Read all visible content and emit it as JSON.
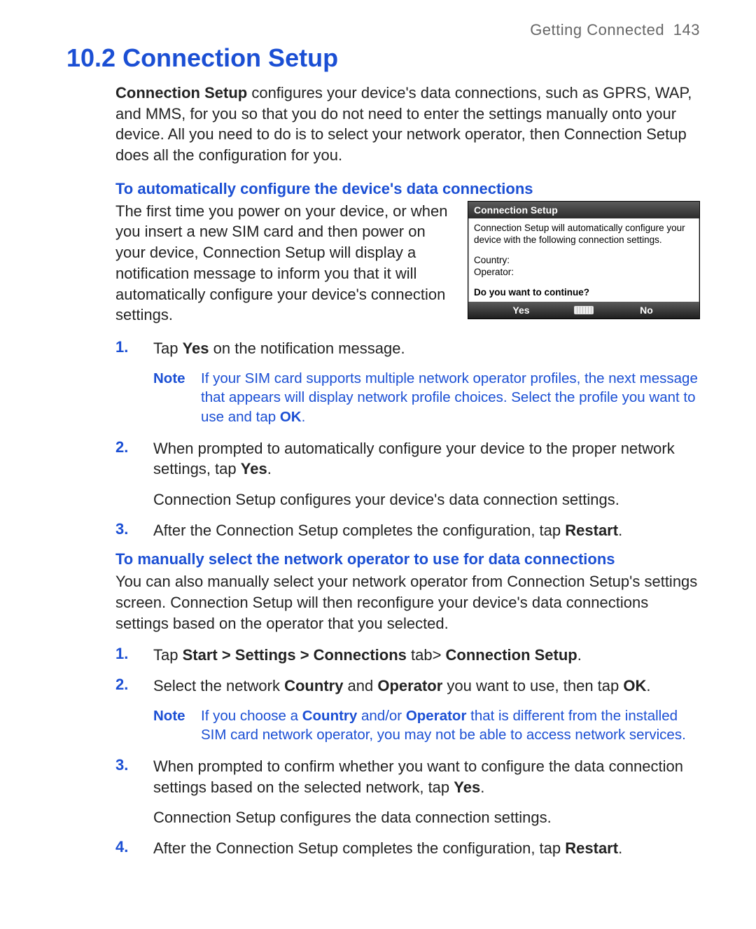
{
  "header": {
    "chapter": "Getting Connected",
    "page": "143"
  },
  "title": "10.2  Connection Setup",
  "intro": {
    "lead_bold": "Connection Setup",
    "text": " configures your device's data connections, such as GPRS, WAP, and MMS, for you so that you do not need to enter the settings manually onto your device. All you need to do is to select your network operator, then Connection Setup does all the configuration for you."
  },
  "auto": {
    "heading": "To automatically configure the device's data connections",
    "para": "The first time you power on your device, or when you insert a new SIM card and then power on your device, Connection Setup will display a notification message to inform you that it will automatically configure your device's connection settings."
  },
  "dialog": {
    "title": "Connection Setup",
    "message": "Connection Setup will automatically configure your device with the following connection settings.",
    "country_label": "Country:",
    "operator_label": "Operator:",
    "confirm": "Do you want to continue?",
    "yes": "Yes",
    "no": "No"
  },
  "steps_a": {
    "s1": {
      "num": "1.",
      "pre": "Tap ",
      "b": "Yes",
      "post": " on the notification message."
    },
    "note": {
      "label": "Note",
      "text_pre": "If your SIM card supports multiple network operator profiles, the next message that appears will display network profile choices. Select the profile you want to use and tap ",
      "b": "OK",
      "text_post": "."
    },
    "s2": {
      "num": "2.",
      "pre": "When prompted to automatically configure your device to the proper network settings, tap ",
      "b": "Yes",
      "post": ".",
      "follow": "Connection Setup configures your device's data connection settings."
    },
    "s3": {
      "num": "3.",
      "pre": "After the Connection Setup completes the configuration, tap ",
      "b": "Restart",
      "post": "."
    }
  },
  "manual": {
    "heading": "To manually select the network operator to use for data connections",
    "para": "You can also manually select your network operator from Connection Setup's settings screen. Connection Setup will then reconfigure your device's data connections settings based on the operator that you selected."
  },
  "steps_b": {
    "s1": {
      "num": "1.",
      "pre": "Tap ",
      "b": "Start > Settings > Connections",
      "mid": " tab> ",
      "b2": "Connection Setup",
      "post": "."
    },
    "s2": {
      "num": "2.",
      "pre": "Select the network ",
      "b": "Country",
      "mid": " and ",
      "b2": "Operator",
      "mid2": " you want to use, then tap ",
      "b3": "OK",
      "post": "."
    },
    "note": {
      "label": "Note",
      "t1": "If you choose a ",
      "b1": "Country",
      "t2": " and/or ",
      "b2": "Operator",
      "t3": " that is different from the installed SIM card network operator, you may not be able to access network services."
    },
    "s3": {
      "num": "3.",
      "pre": "When prompted to confirm whether you want to configure the data connection settings based on the selected network, tap ",
      "b": "Yes",
      "post": ".",
      "follow": "Connection Setup configures the data connection settings."
    },
    "s4": {
      "num": "4.",
      "pre": "After the Connection Setup completes the configuration, tap ",
      "b": "Restart",
      "post": "."
    }
  }
}
